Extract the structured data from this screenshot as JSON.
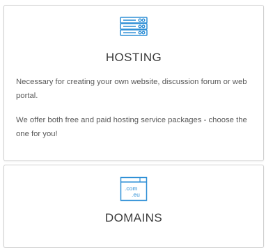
{
  "hosting": {
    "title": "HOSTING",
    "paragraphs": [
      "Necessary for creating your own website, discussion forum or web portal.",
      "We offer both free and paid hosting service packages - choose the one for you!"
    ],
    "icon": "server-icon"
  },
  "domains": {
    "title": "DOMAINS",
    "icon_text_1": ".com",
    "icon_text_2": ".eu",
    "icon": "domain-icon",
    "paragraphs": [
      ""
    ]
  },
  "colors": {
    "accent": "#2e8fd6",
    "text": "#595959",
    "title": "#3a3a3a",
    "border": "#cfcfcf"
  }
}
